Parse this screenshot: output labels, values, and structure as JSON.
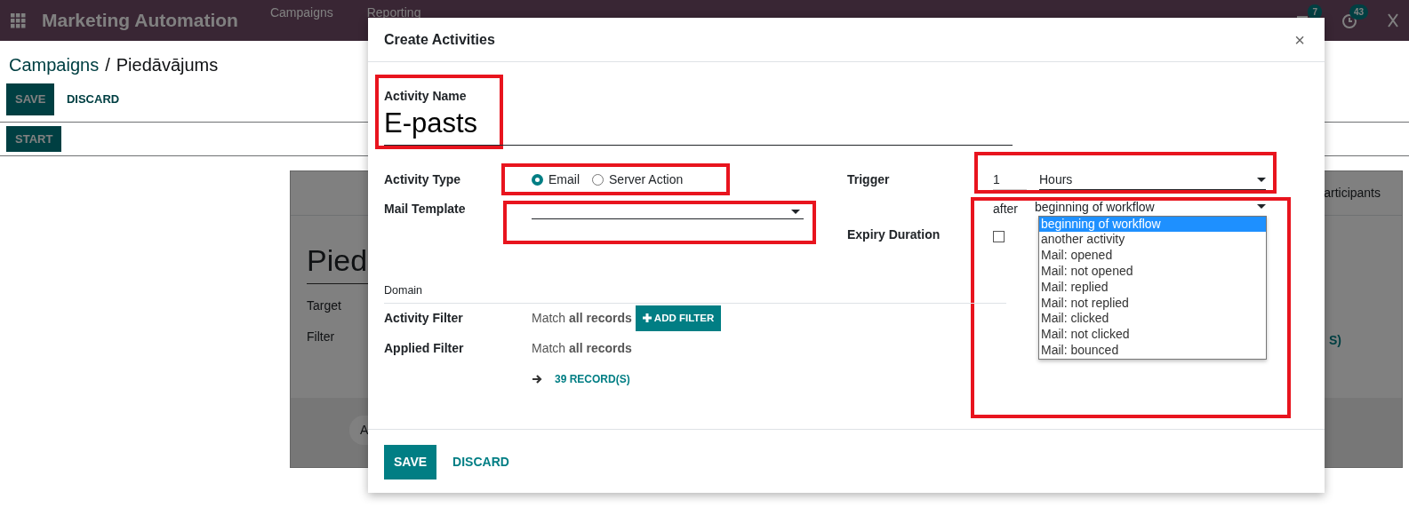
{
  "navbar": {
    "app_title": "Marketing Automation",
    "menu": [
      {
        "label": "Campaigns"
      },
      {
        "label": "Reporting"
      }
    ],
    "notifications": [
      {
        "kind": "chat",
        "count": "7"
      },
      {
        "kind": "activity",
        "count": "43"
      }
    ]
  },
  "breadcrumb": {
    "parent": "Campaigns",
    "separator": "/",
    "current": "Piedāvājums"
  },
  "form_buttons": [
    "SAVE",
    "DISCARD"
  ],
  "status_buttons": [
    "START"
  ],
  "background_card": {
    "tab_fragment": "articipants",
    "title_fragment": "Pied",
    "fields": [
      "Target",
      "Filter"
    ],
    "records_fragment": "S)",
    "footer_fragment": "A"
  },
  "dialog": {
    "title": "Create Activities",
    "close_label": "×",
    "name_label": "Activity Name",
    "name_value": "E-pasts",
    "type_label": "Activity Type",
    "type_options": [
      {
        "label": "Email",
        "selected": true
      },
      {
        "label": "Server Action",
        "selected": false
      }
    ],
    "template_label": "Mail Template",
    "trigger_label": "Trigger",
    "trigger_amount": "1",
    "trigger_unit": "Hours",
    "after_label": "after",
    "trigger_source": "beginning of workflow",
    "source_options": [
      {
        "label": "beginning of workflow",
        "selected": true
      },
      {
        "label": "another activity",
        "selected": false
      },
      {
        "label": "Mail: opened",
        "selected": false
      },
      {
        "label": "Mail: not opened",
        "selected": false
      },
      {
        "label": "Mail: replied",
        "selected": false
      },
      {
        "label": "Mail: not replied",
        "selected": false
      },
      {
        "label": "Mail: clicked",
        "selected": false
      },
      {
        "label": "Mail: not clicked",
        "selected": false
      },
      {
        "label": "Mail: bounced",
        "selected": false
      }
    ],
    "expiry_label": "Expiry Duration",
    "expiry_checked": false,
    "domain_heading": "Domain",
    "activity_filter_label": "Activity Filter",
    "activity_filter_value": "Match **all records**",
    "add_filter_button": "ADD FILTER",
    "applied_filter_label": "Applied Filter",
    "applied_filter_value": "Match **all records**",
    "records_link": "39 RECORD(S)",
    "buttons": [
      "SAVE",
      "DISCARD"
    ]
  },
  "highlights": {
    "name": true,
    "type": true,
    "template": true,
    "trigger": true,
    "source": true
  }
}
